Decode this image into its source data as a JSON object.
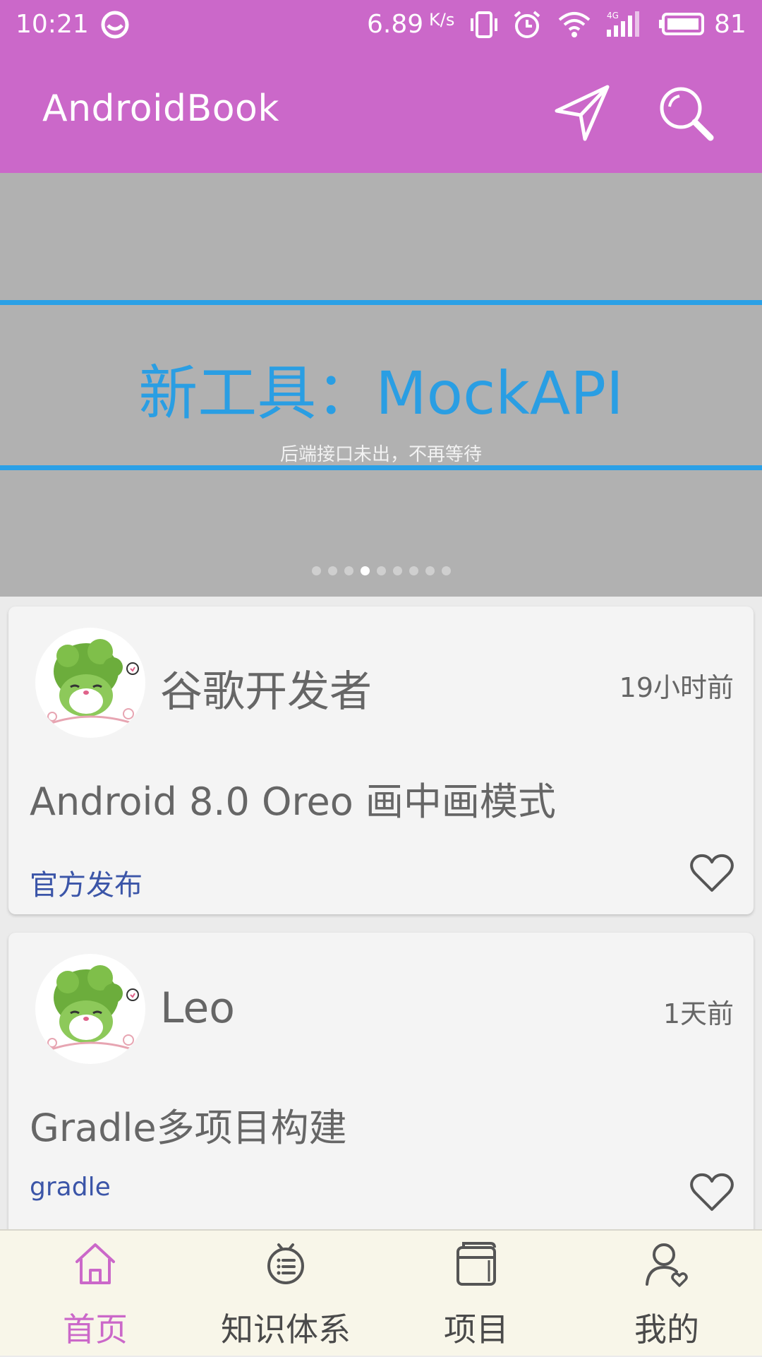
{
  "status_bar": {
    "time": "10:21",
    "net_speed": "6.89",
    "net_speed_unit": "K/s",
    "network_type": "4G",
    "battery": "81",
    "icons": [
      "smiley-icon",
      "vibrate-icon",
      "alarm-icon",
      "wifi-icon",
      "signal-icon",
      "battery-icon"
    ]
  },
  "toolbar": {
    "title": "AndroidBook",
    "actions": [
      "navigate-icon",
      "search-icon"
    ]
  },
  "banner": {
    "title": "新工具：MockAPI",
    "subtitle": "后端接口未出，不再等待",
    "page_count": 9,
    "active_page": 4,
    "title_color": "#2a9ee3",
    "line_color": "#2ba0e6"
  },
  "feed": {
    "articles": [
      {
        "author": "谷歌开发者",
        "time": "19小时前",
        "title": "Android 8.0 Oreo 画中画模式",
        "tag": "官方发布"
      },
      {
        "author": "Leo",
        "time": "1天前",
        "title": "Gradle多项目构建",
        "tag": "gradle"
      }
    ]
  },
  "bottom_nav": {
    "items": [
      {
        "label": "首页",
        "icon": "home-icon",
        "active": true
      },
      {
        "label": "知识体系",
        "icon": "knowledge-icon",
        "active": false
      },
      {
        "label": "项目",
        "icon": "project-icon",
        "active": false
      },
      {
        "label": "我的",
        "icon": "profile-icon",
        "active": false
      }
    ]
  },
  "colors": {
    "primary": "#cb68c9",
    "tag": "#3b55a8",
    "nav_background": "#f8f6e9"
  }
}
